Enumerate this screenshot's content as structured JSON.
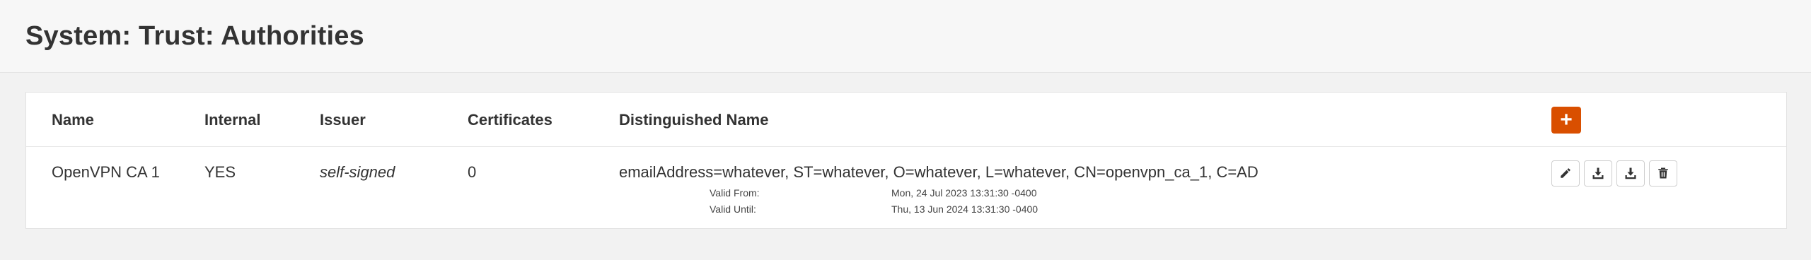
{
  "header": {
    "title": "System: Trust: Authorities"
  },
  "table": {
    "columns": {
      "name": "Name",
      "internal": "Internal",
      "issuer": "Issuer",
      "certificates": "Certificates",
      "dn": "Distinguished Name"
    },
    "add_button": {
      "label": "+",
      "icon": "plus-icon",
      "color": "#d94f00"
    },
    "rows": [
      {
        "name": "OpenVPN CA 1",
        "internal": "YES",
        "issuer": "self-signed",
        "certificates": "0",
        "dn": "emailAddress=whatever, ST=whatever, O=whatever, L=whatever, CN=openvpn_ca_1, C=AD",
        "valid_from_label": "Valid From:",
        "valid_from": "Mon, 24 Jul 2023 13:31:30 -0400",
        "valid_until_label": "Valid Until:",
        "valid_until": "Thu, 13 Jun 2024 13:31:30 -0400",
        "actions": [
          "pencil-icon",
          "download-icon",
          "download-icon",
          "trash-icon"
        ]
      }
    ]
  }
}
